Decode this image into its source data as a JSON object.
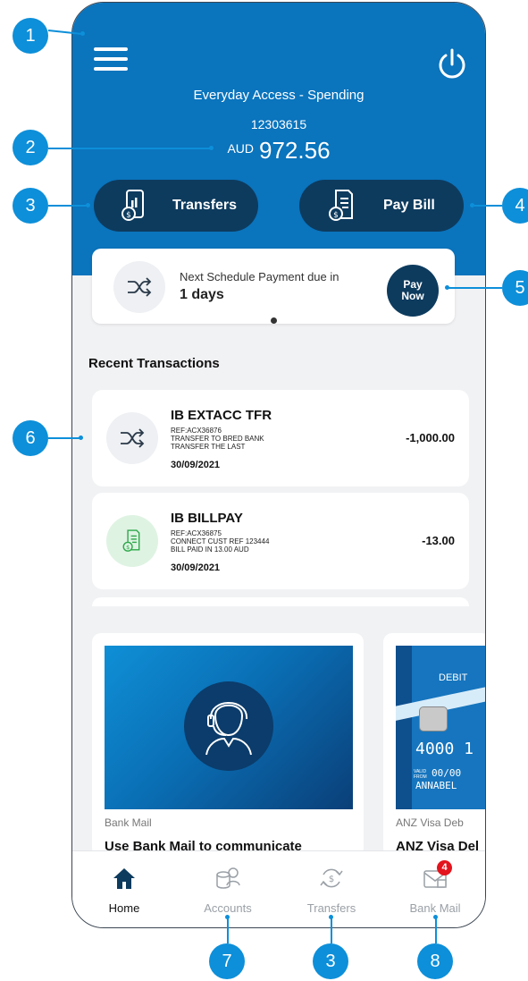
{
  "account": {
    "name": "Everyday Access - Spending",
    "number": "12303615",
    "currency": "AUD",
    "balance": "972.56"
  },
  "actions": {
    "transfers_label": "Transfers",
    "paybill_label": "Pay Bill"
  },
  "schedule": {
    "text": "Next Schedule Payment due in",
    "days": "1 days",
    "pay_now_line1": "Pay",
    "pay_now_line2": "Now"
  },
  "recent": {
    "title": "Recent Transactions",
    "items": [
      {
        "title": "IB EXTACC TFR",
        "ref": "REF:ACX36876",
        "line2": "TRANSFER TO BRED BANK",
        "line3": "TRANSFER THE LAST",
        "date": "30/09/2021",
        "amount": "-1,000.00"
      },
      {
        "title": "IB BILLPAY",
        "ref": "REF:ACX36875",
        "line2": "CONNECT  CUST REF 123444",
        "line3": "BILL PAID IN 13.00 AUD",
        "date": "30/09/2021",
        "amount": "-13.00"
      }
    ]
  },
  "promos": [
    {
      "tag": "Bank Mail",
      "headline": "Use Bank Mail to communicate"
    },
    {
      "tag": "ANZ Visa Deb",
      "headline": "ANZ Visa Del",
      "card_label": "DEBIT",
      "card_number": "4000 1",
      "card_valid_label": "VALID FROM",
      "card_expiry": "00/00",
      "card_name": "ANNABEL"
    }
  ],
  "tabs": [
    {
      "label": "Home"
    },
    {
      "label": "Accounts"
    },
    {
      "label": "Transfers"
    },
    {
      "label": "Bank Mail",
      "badge": "4"
    }
  ],
  "callouts": [
    "1",
    "2",
    "3",
    "4",
    "5",
    "6",
    "7",
    "3",
    "8"
  ],
  "colors": {
    "header_blue": "#0a74bd",
    "navy": "#0d3b5e",
    "callout_blue": "#0d8fd9",
    "badge_red": "#e3141d"
  }
}
